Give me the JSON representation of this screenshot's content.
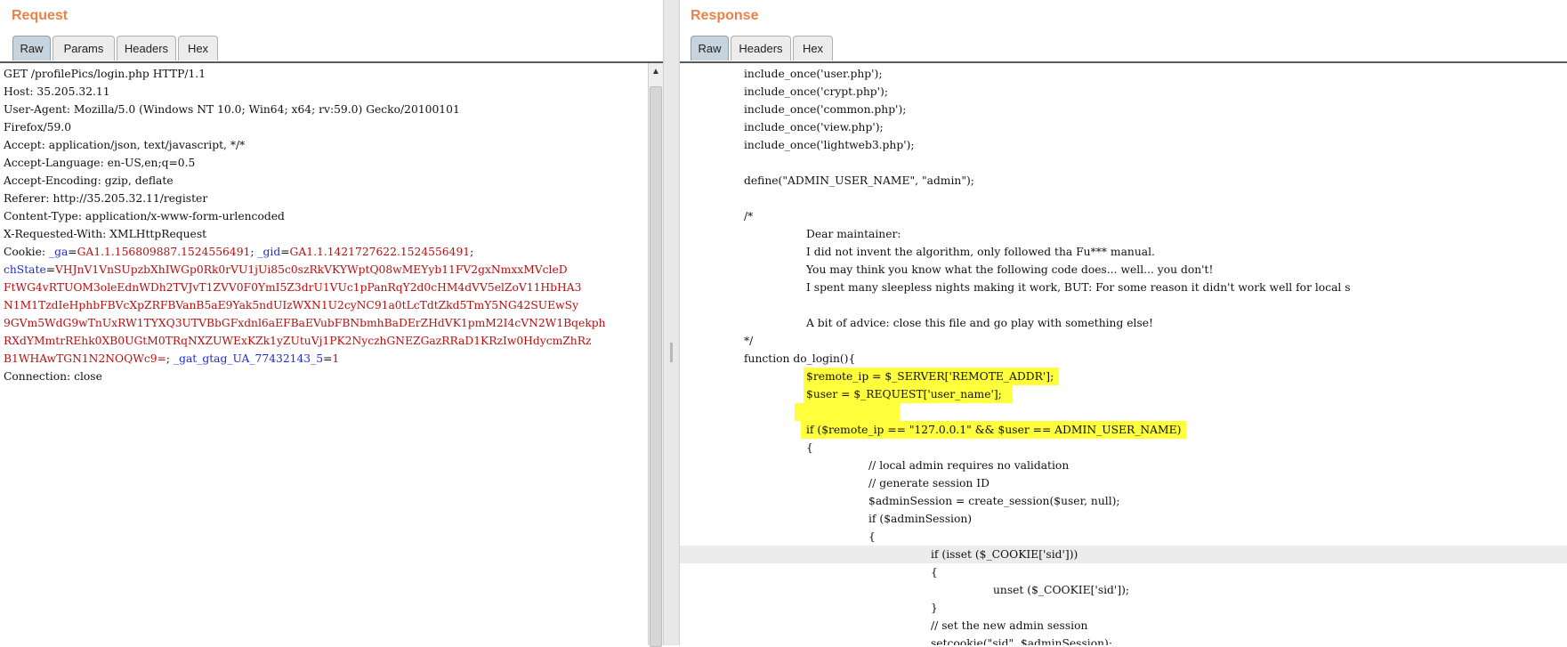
{
  "request": {
    "title": "Request",
    "tabs": [
      "Raw",
      "Params",
      "Headers",
      "Hex"
    ],
    "active_tab": "Raw",
    "lines": [
      "GET /profilePics/login.php HTTP/1.1",
      "Host: 35.205.32.11",
      "User-Agent: Mozilla/5.0 (Windows NT 10.0; Win64; x64; rv:59.0) Gecko/20100101",
      "Firefox/59.0",
      "Accept: application/json, text/javascript, */*",
      "Accept-Language: en-US,en;q=0.5",
      "Accept-Encoding: gzip, deflate",
      "Referer: http://35.205.32.11/register",
      "Content-Type: application/x-www-form-urlencoded",
      "X-Requested-With: XMLHttpRequest"
    ],
    "cookie": {
      "label": "Cookie: ",
      "ga_key": "_ga",
      "ga_value": "GA1.1.156809887.1524556491",
      "gid_key": "_gid",
      "gid_value": "GA1.1.1421727622.1524556491",
      "chstate_key": "chState",
      "chstate_lines": [
        "VHJnV1VnSUpzbXhIWGp0Rk0rVU1jUi85c0szRkVKYWptQ08wMEYyb11FV2gxNmxxMVcleD",
        "FtWG4vRTUOM3oleEdnWDh2TVJvT1ZVV0F0YmI5Z3drU1VUc1pPanRqY2d0cHM4dVV5elZoV11HbHA3",
        "N1M1TzdIeHphbFBVcXpZRFBVanB5aE9Yak5ndUIzWXN1U2cyNC91a0tLcTdtZkd5TmY5NG42SUEwSy",
        "9GVm5WdG9wTnUxRW1TYXQ3UTVBbGFxdnl6aEFBaEVubFBNbmhBaDErZHdVK1pmM2I4cVN2W1Bqekph",
        "RXdYMmtrREhk0XB0UGtM0TRqNXZUWExKZk1yZUtuVj1PK2NyczhGNEZGazRRaD1KRzIw0HdycmZhRz",
        "B1WHAwTGN1N2NOQWc9="
      ],
      "gat_key": "_gat_gtag_UA_77432143_5",
      "gat_value": "1"
    },
    "last_line": "Connection: close"
  },
  "response": {
    "title": "Response",
    "tabs": [
      "Raw",
      "Headers",
      "Hex"
    ],
    "active_tab": "Raw",
    "lines": [
      "include_once('user.php');",
      "include_once('crypt.php');",
      "include_once('common.php');",
      "include_once('view.php');",
      "include_once('lightweb3.php');",
      "",
      "define(\"ADMIN_USER_NAME\", \"admin\");",
      "",
      "/*",
      "Dear maintainer:",
      "I did not invent the algorithm, only followed tha Fu*** manual.",
      "You may think you know what the following code does... well... you don't!",
      "I spent many sleepless nights making it work, BUT: For some reason it didn't work well for local s",
      "",
      "A bit of advice: close this file and go play with something else!",
      "*/",
      "function do_login(){",
      "$remote_ip = $_SERVER['REMOTE_ADDR'];",
      "$user = $_REQUEST['user_name'];",
      "",
      "if ($remote_ip == \"127.0.0.1\" && $user == ADMIN_USER_NAME)",
      "{",
      "// local admin requires no validation",
      "// generate session ID",
      "$adminSession = create_session($user, null);",
      "if ($adminSession)",
      "{",
      "if (isset ($_COOKIE['sid']))",
      "{",
      "unset ($_COOKIE['sid']);",
      "}",
      "// set the new admin session",
      "setcookie(\"sid\", $adminSession);"
    ]
  },
  "colors": {
    "title_orange": "#e8824a",
    "cookie_key_blue": "#1f2ad0",
    "cookie_value_red": "#b80f0f",
    "highlight_yellow": "#ffff3b",
    "active_tab": "#c7d3dd"
  }
}
